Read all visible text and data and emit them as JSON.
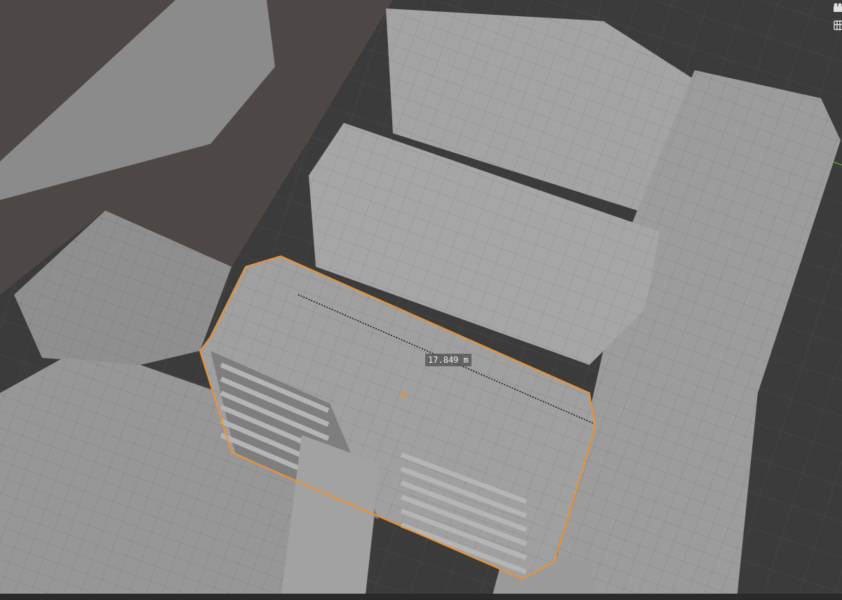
{
  "viewport": {
    "selected_object": {
      "selected": true
    },
    "measurement": {
      "label": "17.849 m"
    }
  }
}
